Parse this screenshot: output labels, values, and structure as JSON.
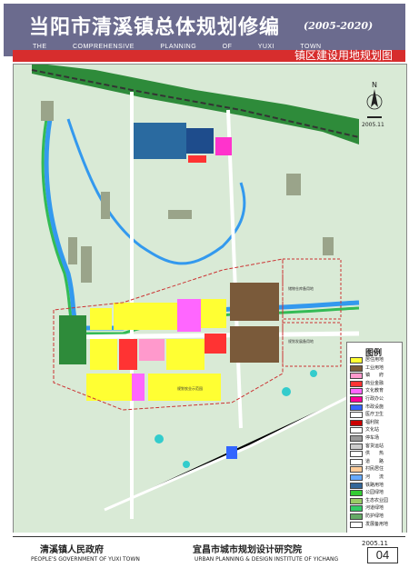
{
  "header": {
    "title_cn": "当阳市清溪镇总体规划修编",
    "years": "(2005-2020)",
    "title_en_words": [
      "THE",
      "COMPREHENSIVE",
      "PLANNING",
      "OF",
      "YUXI",
      "TOWN"
    ],
    "subtitle": "镇区建设用地规划图"
  },
  "legend": {
    "title": "图例",
    "items": [
      {
        "label": "居住用地",
        "color": "#ffff33"
      },
      {
        "label": "工业用地",
        "color": "#7a5a3a"
      },
      {
        "label": "镇　　府",
        "color": "#ff99cc"
      },
      {
        "label": "商业金融",
        "color": "#ff3333"
      },
      {
        "label": "文化教育",
        "color": "#ff66ff"
      },
      {
        "label": "行政办公",
        "color": "#ff0099"
      },
      {
        "label": "市政设施",
        "color": "#3366ff"
      },
      {
        "label": "医疗卫生",
        "color": "#ffffff"
      },
      {
        "label": "福利院",
        "color": "#cc0000"
      },
      {
        "label": "文化站",
        "color": "#ffffff"
      },
      {
        "label": "停车场",
        "color": "#999999"
      },
      {
        "label": "客货运站",
        "color": "#cccccc"
      },
      {
        "label": "供　　热",
        "color": "#ffffff"
      },
      {
        "label": "道　　路",
        "color": "#ffffff"
      },
      {
        "label": "村民居住",
        "color": "#ffcc99"
      },
      {
        "label": "河　　流",
        "color": "#66aaff"
      },
      {
        "label": "铁路用地",
        "color": "#336699"
      },
      {
        "label": "公园绿地",
        "color": "#33cc33"
      },
      {
        "label": "生态农业园",
        "color": "#99cc66"
      },
      {
        "label": "河道绿地",
        "color": "#33cc66"
      },
      {
        "label": "防护绿地",
        "color": "#66aa66"
      },
      {
        "label": "发展备用地",
        "color": "#ffffff"
      }
    ]
  },
  "map": {
    "north_label": "N",
    "scale_label": "2005.11",
    "area_labels": [
      "储物仓库备用地",
      "规划发展备用地",
      "规划农业示范园"
    ]
  },
  "footer": {
    "left_cn": "清溪镇人民政府",
    "left_en": "PEOPLE'S GOVERNMENT OF YUXI TOWN",
    "right_cn": "宜昌市城市规划设计研究院",
    "right_en": "URBAN PLANNING & DESIGN INSTITUTE OF YICHANG",
    "date": "2005.11",
    "page": "04"
  }
}
